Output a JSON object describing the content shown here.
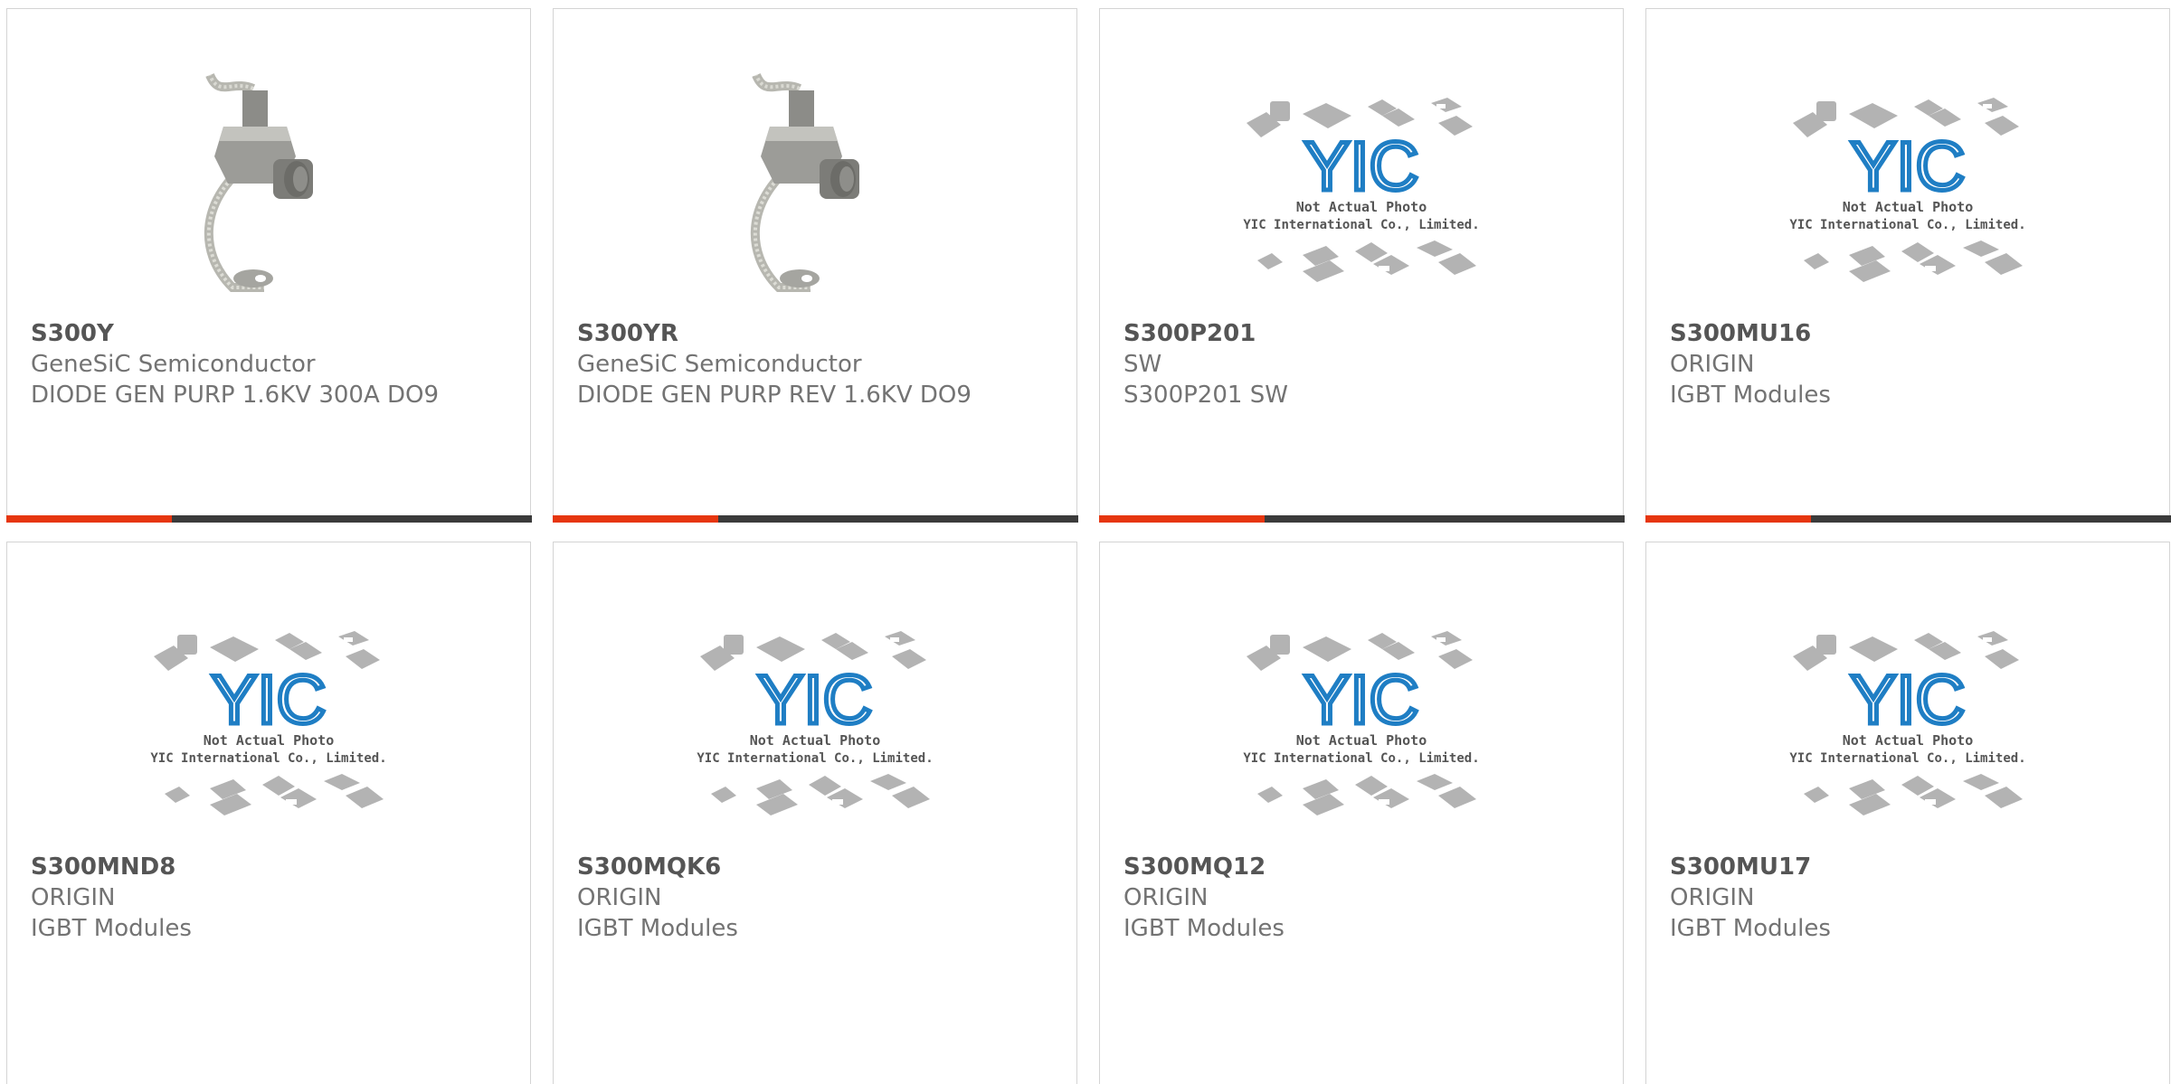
{
  "products": [
    {
      "part": "S300Y",
      "brand": "GeneSiC Semiconductor",
      "desc": "DIODE GEN PURP 1.6KV 300A DO9",
      "image": "diode-photo"
    },
    {
      "part": "S300YR",
      "brand": "GeneSiC Semiconductor",
      "desc": "DIODE GEN PURP REV 1.6KV DO9",
      "image": "diode-photo"
    },
    {
      "part": "S300P201",
      "brand": "SW",
      "desc": "S300P201 SW",
      "image": "placeholder"
    },
    {
      "part": "S300MU16",
      "brand": "ORIGIN",
      "desc": "IGBT Modules",
      "image": "placeholder"
    },
    {
      "part": "S300MND8",
      "brand": "ORIGIN",
      "desc": "IGBT Modules",
      "image": "placeholder"
    },
    {
      "part": "S300MQK6",
      "brand": "ORIGIN",
      "desc": "IGBT Modules",
      "image": "placeholder"
    },
    {
      "part": "S300MQ12",
      "brand": "ORIGIN",
      "desc": "IGBT Modules",
      "image": "placeholder"
    },
    {
      "part": "S300MU17",
      "brand": "ORIGIN",
      "desc": "IGBT Modules",
      "image": "placeholder"
    }
  ],
  "placeholder": {
    "logo": "YIC",
    "line1": "Not Actual Photo",
    "line2": "YIC International Co., Limited."
  },
  "colors": {
    "accent": "#e6360f",
    "bar": "#3b3b3b",
    "logo_blue": "#1f7ec4"
  }
}
